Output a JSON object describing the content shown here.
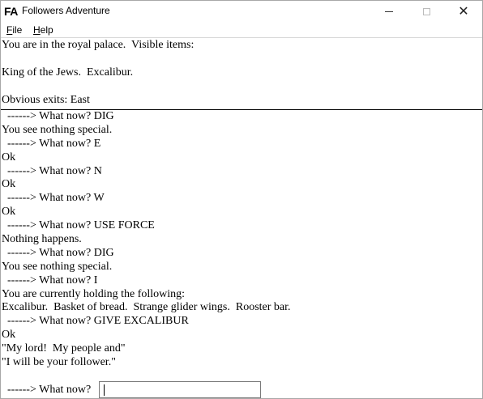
{
  "window": {
    "icon_text": "FA",
    "title": "Followers Adventure",
    "minimize_icon": "minimize-icon",
    "maximize_icon": "maximize-icon",
    "close_icon": "close-icon"
  },
  "menu": {
    "items": [
      {
        "label": "File",
        "underline": "F"
      },
      {
        "label": "Help",
        "underline": "H"
      }
    ]
  },
  "room": {
    "lines": [
      "You are in the royal palace.  Visible items:",
      "",
      "King of the Jews.  Excalibur.",
      "",
      "Obvious exits: East"
    ]
  },
  "log": {
    "lines": [
      "  ------> What now? DIG",
      "You see nothing special.",
      "  ------> What now? E",
      "Ok",
      "  ------> What now? N",
      "Ok",
      "  ------> What now? W",
      "Ok",
      "  ------> What now? USE FORCE",
      "Nothing happens.",
      "  ------> What now? DIG",
      "You see nothing special.",
      "  ------> What now? I",
      "You are currently holding the following:",
      "Excalibur.  Basket of bread.  Strange glider wings.  Rooster bar.",
      "  ------> What now? GIVE EXCALIBUR",
      "Ok",
      "\"My lord!  My people and\"",
      "\"I will be your follower.\""
    ]
  },
  "prompt": {
    "label": "  ------> What now?",
    "value": ""
  }
}
